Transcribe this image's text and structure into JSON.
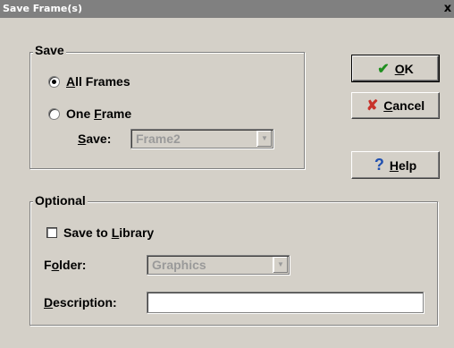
{
  "window": {
    "title": "Save Frame(s)",
    "close_glyph": "x"
  },
  "save_group": {
    "label": "Save",
    "all_frames": {
      "pre": "",
      "key": "A",
      "post": "ll Frames",
      "selected": true
    },
    "one_frame": {
      "pre": "One ",
      "key": "F",
      "post": "rame",
      "selected": false
    },
    "save_field": {
      "key": "S",
      "post": "ave:",
      "value": "Frame2"
    }
  },
  "optional_group": {
    "label": "Optional",
    "save_to_library": {
      "pre": "Save to ",
      "key": "L",
      "post": "ibrary",
      "checked": false
    },
    "folder": {
      "pre": "F",
      "key": "o",
      "post": "lder:",
      "value": "Graphics"
    },
    "description": {
      "key": "D",
      "post": "escription:",
      "value": ""
    }
  },
  "buttons": {
    "ok": {
      "key": "O",
      "post": "K",
      "icon": "checkmark-icon",
      "icon_color": "#1f8f1f"
    },
    "cancel": {
      "key": "C",
      "post": "ancel",
      "icon": "x-icon",
      "icon_color": "#c8322a"
    },
    "help": {
      "key": "H",
      "post": "elp",
      "icon": "question-icon",
      "icon_color": "#1f4fb0"
    }
  }
}
